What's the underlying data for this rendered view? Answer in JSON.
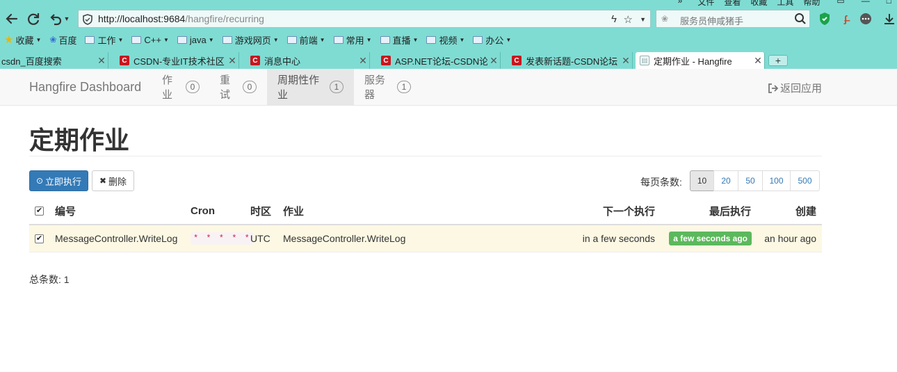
{
  "browser": {
    "menu": [
      "文件",
      "查看",
      "收藏",
      "工具",
      "帮助"
    ],
    "menu_arrows": "»",
    "url_host": "http://localhost:9684",
    "url_path": "/hangfire/recurring",
    "search_placeholder": "服务员伸咸猪手",
    "bookmarks": [
      {
        "label": "收藏",
        "icon": "star-icon",
        "caret": true
      },
      {
        "label": "百度",
        "icon": "paw-icon",
        "caret": false
      },
      {
        "label": "工作",
        "icon": "folder-icon",
        "caret": true
      },
      {
        "label": "C++",
        "icon": "folder-icon",
        "caret": true
      },
      {
        "label": "java",
        "icon": "folder-icon",
        "caret": true
      },
      {
        "label": "游戏网页",
        "icon": "folder-icon",
        "caret": true
      },
      {
        "label": "前端",
        "icon": "folder-icon",
        "caret": true
      },
      {
        "label": "常用",
        "icon": "folder-icon",
        "caret": true
      },
      {
        "label": "直播",
        "icon": "folder-icon",
        "caret": true
      },
      {
        "label": "视频",
        "icon": "folder-icon",
        "caret": true
      },
      {
        "label": "办公",
        "icon": "folder-icon",
        "caret": true
      }
    ],
    "tabs": [
      {
        "title": "csdn_百度搜索",
        "favicon": "",
        "active": false
      },
      {
        "title": "CSDN-专业IT技术社区",
        "favicon": "C",
        "active": false
      },
      {
        "title": "消息中心",
        "favicon": "C",
        "active": false
      },
      {
        "title": "ASP.NET论坛-CSDN论坛",
        "favicon": "C",
        "active": false
      },
      {
        "title": "发表新话题-CSDN论坛",
        "favicon": "C",
        "active": false
      },
      {
        "title": "定期作业 - Hangfire",
        "favicon": "doc",
        "active": true
      }
    ],
    "new_tab": "+"
  },
  "nav": {
    "brand": "Hangfire Dashboard",
    "items": [
      {
        "label": "作业",
        "count": "0",
        "active": false
      },
      {
        "label": "重试",
        "count": "0",
        "active": false
      },
      {
        "label": "周期性作业",
        "count": "1",
        "active": true
      },
      {
        "label": "服务器",
        "count": "1",
        "active": false
      }
    ],
    "back_label": "返回应用"
  },
  "page": {
    "title": "定期作业",
    "run_button": "立即执行",
    "delete_button": "删除",
    "per_page_label": "每页条数:",
    "per_page_options": [
      "10",
      "20",
      "50",
      "100",
      "500"
    ],
    "per_page_selected": "10",
    "total": "总条数: 1"
  },
  "table": {
    "headers": {
      "id": "编号",
      "cron": "Cron",
      "timezone": "时区",
      "job": "作业",
      "next": "下一个执行",
      "last": "最后执行",
      "created": "创建"
    },
    "header_checked": true,
    "rows": [
      {
        "checked": true,
        "id": "MessageController.WriteLog",
        "cron": "* * * * *",
        "timezone": "UTC",
        "job": "MessageController.WriteLog",
        "next": "in a few seconds",
        "last": "a few seconds ago",
        "created": "an hour ago"
      }
    ]
  },
  "colors": {
    "chrome_bg": "#7fdcd3",
    "primary": "#337ab7",
    "success": "#5cb85c",
    "row_warning_bg": "#fcf8e3",
    "cron_code": "#c7254e"
  }
}
